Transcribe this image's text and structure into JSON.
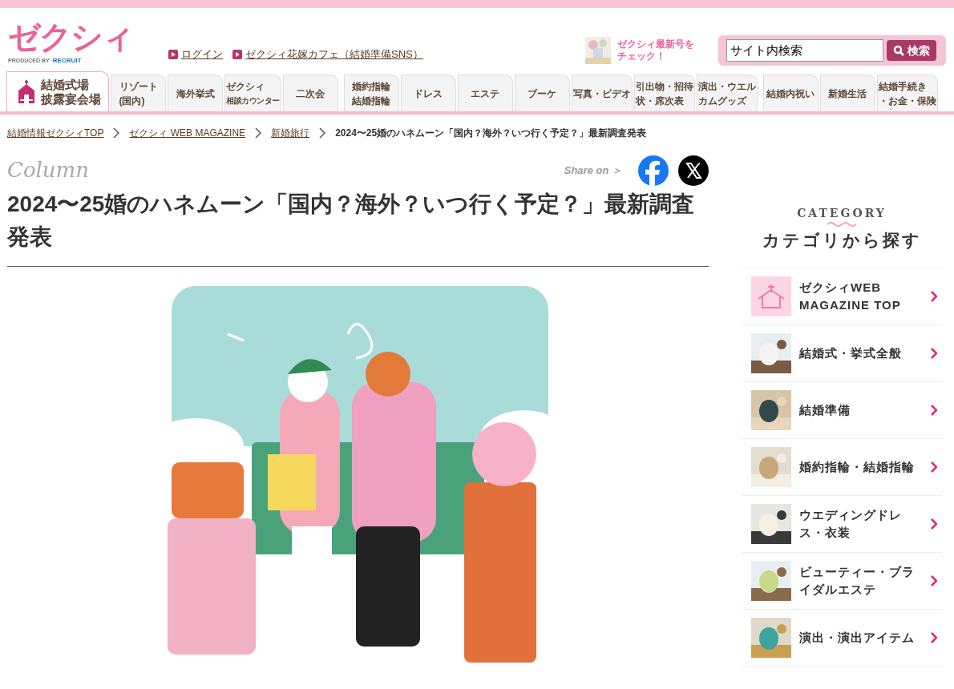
{
  "header": {
    "logo": "ゼクシィ",
    "logo_tagline": "PRODUCED BY",
    "logo_brand": "RECRUIT",
    "links": [
      "ログイン",
      "ゼクシィ花嫁カフェ（結婚準備SNS）"
    ],
    "promo": {
      "lines": [
        "ゼクシィ最新号を",
        "チェック！"
      ]
    },
    "search": {
      "value": "サイト内検索",
      "button": "検索"
    }
  },
  "nav": [
    {
      "lines": [
        "結婚式場",
        "披露宴会場"
      ],
      "kind": "icon",
      "selected": true
    },
    {
      "lines": [
        "リゾート",
        "(国内)"
      ],
      "kind": "text",
      "selected": false
    },
    {
      "lines": [
        "海外挙式"
      ],
      "kind": "text",
      "selected": false
    },
    {
      "lines": [
        "ゼクシィ",
        "相談カウンター"
      ],
      "kind": "text",
      "selected": false
    },
    {
      "lines": [
        "二次会"
      ],
      "kind": "text",
      "selected": false
    },
    {
      "lines": [
        "婚約指輪",
        "結婚指輪"
      ],
      "kind": "text",
      "selected": false
    },
    {
      "lines": [
        "ドレス"
      ],
      "kind": "text",
      "selected": false
    },
    {
      "lines": [
        "エステ"
      ],
      "kind": "text",
      "selected": false
    },
    {
      "lines": [
        "ブーケ"
      ],
      "kind": "text",
      "selected": false
    },
    {
      "lines": [
        "写真・ビデオ"
      ],
      "kind": "text",
      "selected": false
    },
    {
      "lines": [
        "引出物・招待",
        "状・席次表"
      ],
      "kind": "text",
      "selected": false
    },
    {
      "lines": [
        "演出・ウエル",
        "カムグッズ"
      ],
      "kind": "text",
      "selected": false
    },
    {
      "lines": [
        "結婚内祝い"
      ],
      "kind": "text",
      "selected": false
    },
    {
      "lines": [
        "新婚生活"
      ],
      "kind": "text",
      "selected": false
    },
    {
      "lines": [
        "結婚手続き",
        "・お金・保険"
      ],
      "kind": "text",
      "selected": false
    }
  ],
  "breadcrumb": [
    {
      "label": "結婚情報ゼクシィTOP",
      "link": true
    },
    {
      "label": "ゼクシィ WEB MAGAZINE",
      "link": true
    },
    {
      "label": "新婚旅行",
      "link": true
    },
    {
      "label": "2024〜25婚のハネムーン「国内？海外？いつ行く予定？」最新調査発表",
      "link": false
    }
  ],
  "article": {
    "label": "Column",
    "share_label": "Share on ＞",
    "title": "2024〜25婚のハネムーン「国内？海外？いつ行く予定？」最新調査発表"
  },
  "sidebar": {
    "eyebrow": "CATEGORY",
    "heading": "カテゴリから探す",
    "items": [
      {
        "label": "ゼクシィWEB MAGAZINE TOP",
        "kind": "icon"
      },
      {
        "label": "結婚式・挙式全般"
      },
      {
        "label": "結婚準備"
      },
      {
        "label": "婚約指輪・結婚指輪"
      },
      {
        "label": "ウエディングドレス・衣装"
      },
      {
        "label": "ビューティー・ブライダルエステ"
      },
      {
        "label": "演出・演出アイテム"
      }
    ]
  }
}
